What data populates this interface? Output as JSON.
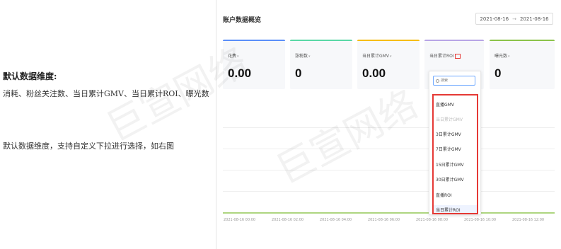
{
  "notes": {
    "title": "默认数据维度:",
    "line1": "消耗、粉丝关注数、当日累计GMV、当日累计ROI、曝光数",
    "line2": "默认数据维度，支持自定义下拉进行选择，如右图"
  },
  "dashboard": {
    "title": "账户数据概览",
    "date_start": "2021-08-16",
    "date_sep": "→",
    "date_end": "2021-08-16"
  },
  "cards": [
    {
      "label": "花费",
      "value": "0.00",
      "color": "#5b8ff9"
    },
    {
      "label": "涨粉数",
      "value": "0",
      "color": "#5ad8a6"
    },
    {
      "label": "当日累计GMV",
      "value": "0.00",
      "color": "#f6bd16"
    },
    {
      "label": "当日累计ROI",
      "value": "",
      "color": "#b8a5e6"
    },
    {
      "label": "曝光数",
      "value": "0",
      "color": "#8bc34a"
    }
  ],
  "dropdown": {
    "search_placeholder": "搜索",
    "options": [
      {
        "label": "直播GMV",
        "disabled": false
      },
      {
        "label": "当日累计GMV",
        "disabled": true
      },
      {
        "label": "3日累计GMV",
        "disabled": false
      },
      {
        "label": "7日累计GMV",
        "disabled": false
      },
      {
        "label": "15日累计GMV",
        "disabled": false
      },
      {
        "label": "30日累计GMV",
        "disabled": false
      },
      {
        "label": "直播ROI",
        "disabled": false
      },
      {
        "label": "当日累计ROI",
        "disabled": false,
        "selected": true
      }
    ]
  },
  "chart": {
    "x_ticks": [
      "2021-08-16 00:00",
      "2021-08-16 02:00",
      "2021-08-16 04:00",
      "2021-08-16 06:00",
      "2021-08-16 08:00",
      "2021-08-16 10:00",
      "2021-08-16 12:00"
    ]
  },
  "watermark": "巨宣网络"
}
